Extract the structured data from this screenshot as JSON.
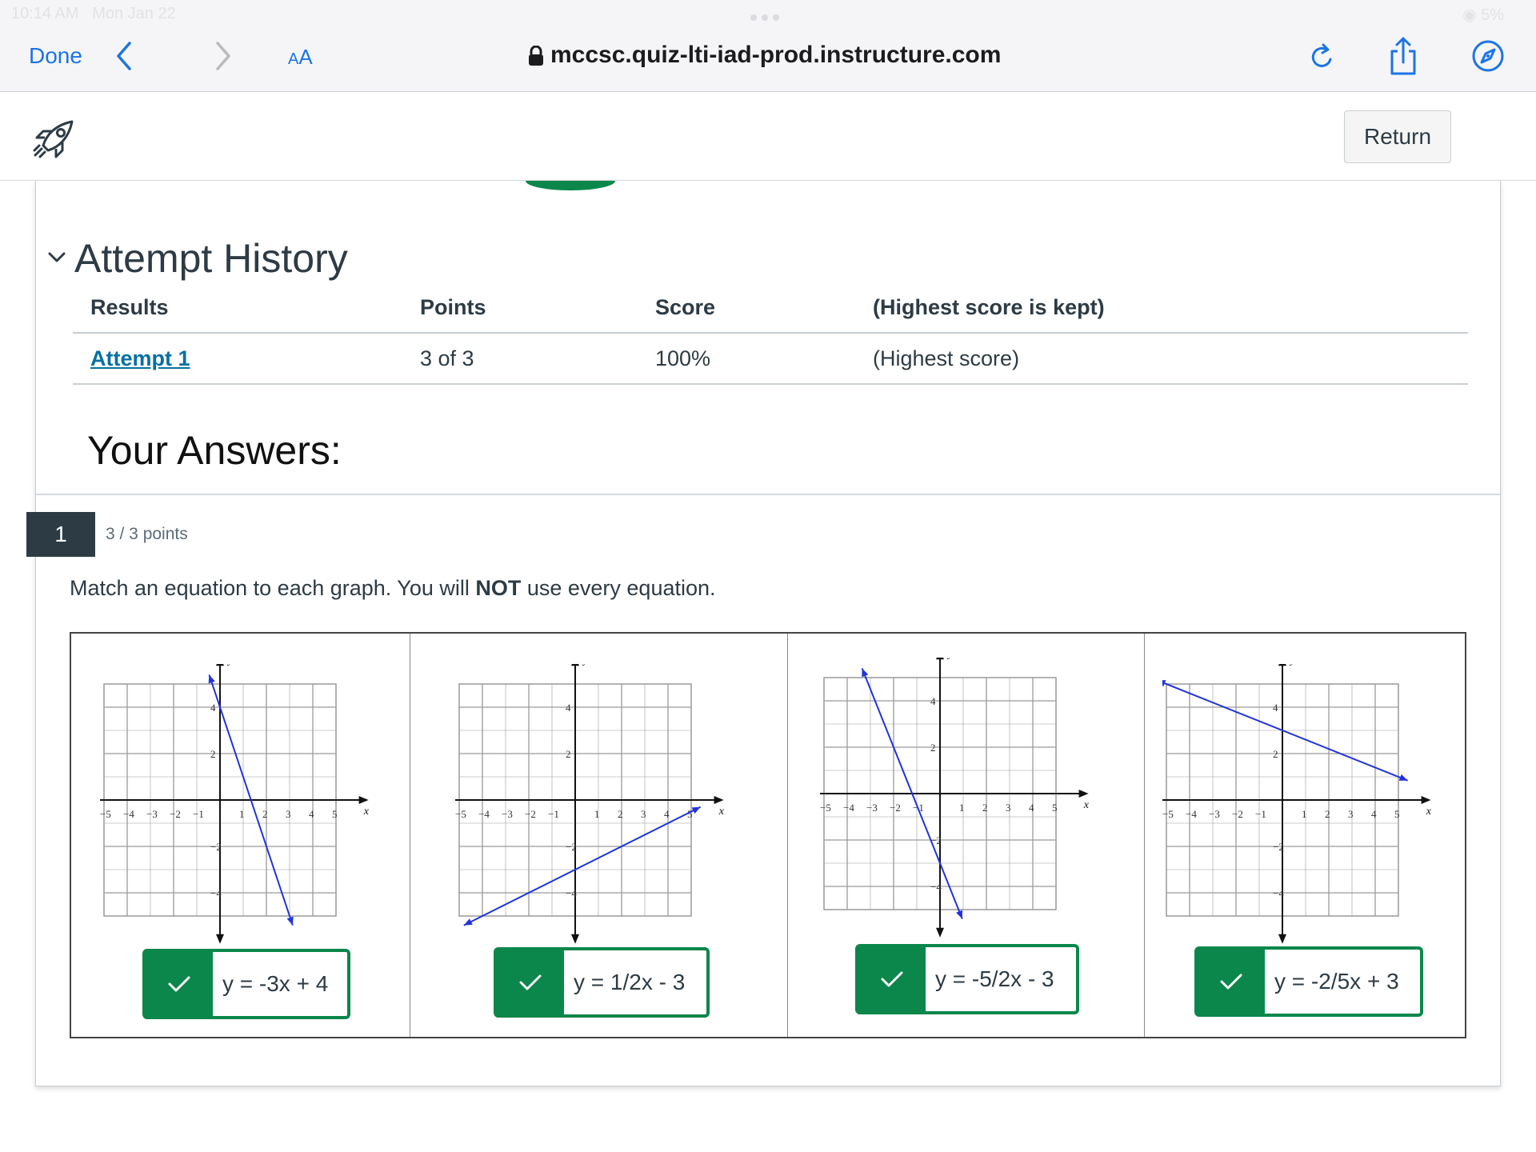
{
  "status": {
    "time": "10:14 AM",
    "date": "Mon Jan 22",
    "battery": "5%"
  },
  "browser": {
    "done_label": "Done",
    "aa_label_small": "A",
    "aa_label_big": "A",
    "url": "mccsc.quiz-lti-iad-prod.instructure.com"
  },
  "app": {
    "return_label": "Return"
  },
  "attempt_history": {
    "title": "Attempt History",
    "headers": [
      "Results",
      "Points",
      "Score",
      "(Highest score is kept)"
    ],
    "rows": [
      {
        "result": "Attempt 1",
        "points": "3 of 3",
        "score": "100%",
        "note": "(Highest score)"
      }
    ]
  },
  "your_answers_title": "Your Answers:",
  "question": {
    "number": "1",
    "points": "3 / 3 points",
    "text_before": "Match an equation to each graph. You will ",
    "text_bold": "NOT",
    "text_after": " use every equation.",
    "graphs": [
      {
        "answer": "y = -3x + 4",
        "slope": -3,
        "intercept": 4,
        "correct": true
      },
      {
        "answer": "y = 1/2x - 3",
        "slope": 0.5,
        "intercept": -3,
        "correct": true
      },
      {
        "answer": "y = -5/2x - 3",
        "slope": -2.5,
        "intercept": -3,
        "correct": true
      },
      {
        "answer": "y = -2/5x + 3",
        "slope": -0.4,
        "intercept": 3,
        "correct": true
      }
    ],
    "axis": {
      "x_label": "x",
      "y_label": "y",
      "x_ticks": [
        "−5",
        "−4",
        "−3",
        "−2",
        "−1",
        "1",
        "2",
        "3",
        "4",
        "5"
      ],
      "y_ticks": [
        "4",
        "2",
        "−2",
        "−4"
      ]
    }
  },
  "colors": {
    "success_green": "#0b874b",
    "link_blue": "#0770a3",
    "line_blue": "#2233dd",
    "safari_blue": "#1b74e4"
  }
}
